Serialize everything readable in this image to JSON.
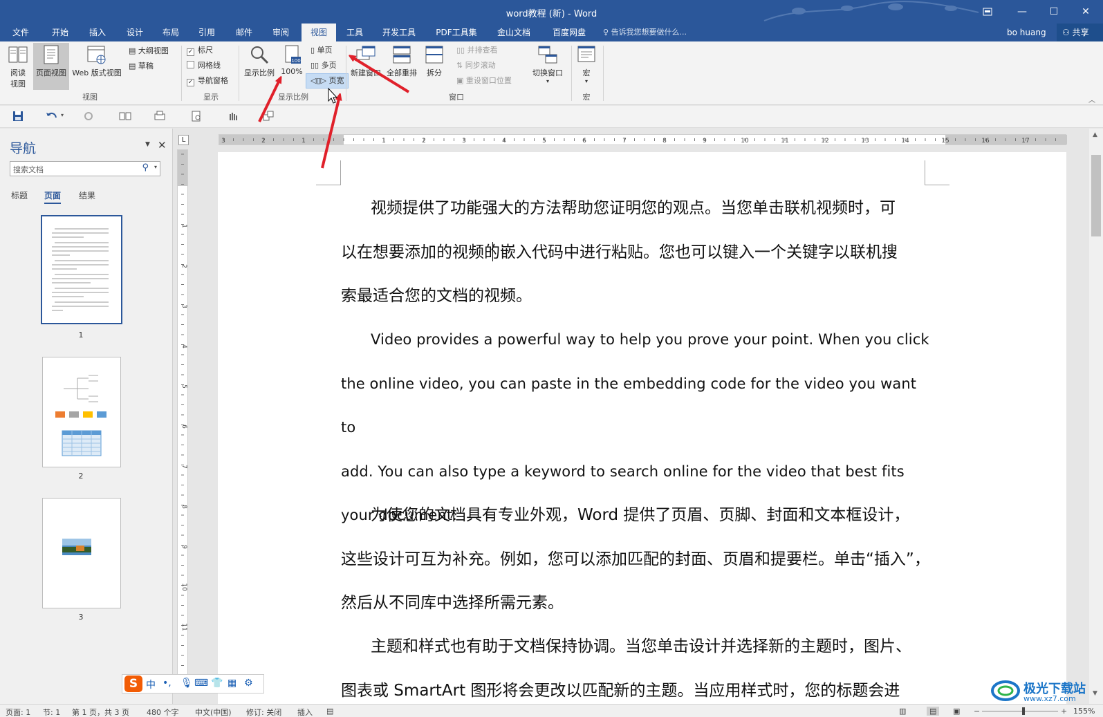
{
  "window": {
    "title": "word教程 (新) - Word",
    "restore_icon": "ribbon-display-icon",
    "minimize": "—",
    "maximize": "☐",
    "close": "✕"
  },
  "tabs": [
    "文件",
    "开始",
    "插入",
    "设计",
    "布局",
    "引用",
    "邮件",
    "审阅",
    "视图",
    "工具",
    "开发工具",
    "PDF工具集",
    "金山文档",
    "百度网盘"
  ],
  "active_tab": "视图",
  "tell_me": "告诉我您想要做什么...",
  "user": "bo huang",
  "share": "共享",
  "ribbon": {
    "views": {
      "read_mode": "阅读\n视图",
      "read_mode_l1": "阅读",
      "read_mode_l2": "视图",
      "print_layout": "页面视图",
      "web_layout": "Web 版式视图",
      "outline": "大纲视图",
      "draft": "草稿",
      "group": "视图"
    },
    "show": {
      "ruler": "标尺",
      "ruler_checked": true,
      "gridlines": "网格线",
      "gridlines_checked": false,
      "nav_pane": "导航窗格",
      "nav_pane_checked": true,
      "group": "显示"
    },
    "zoom": {
      "zoom": "显示比例",
      "hundred": "100%",
      "hundred_badge": "100",
      "one_page": "单页",
      "multi_page": "多页",
      "page_width": "页宽",
      "group": "显示比例"
    },
    "window": {
      "new_window": "新建窗口",
      "arrange_all": "全部重排",
      "split": "拆分",
      "side_by_side": "并排查看",
      "sync_scroll": "同步滚动",
      "reset_position": "重设窗口位置",
      "switch_windows": "切换窗口",
      "group": "窗口"
    },
    "macros": {
      "macros": "宏",
      "group": "宏"
    }
  },
  "nav": {
    "title": "导航",
    "search_placeholder": "搜索文档",
    "subtabs": [
      "标题",
      "页面",
      "结果"
    ],
    "active_subtab": "页面",
    "pages": [
      "1",
      "2",
      "3"
    ]
  },
  "ruler": {
    "tab_selector": "L",
    "h_labels": [
      "3",
      "2",
      "1",
      "1",
      "2",
      "3",
      "4",
      "5",
      "6",
      "7",
      "8",
      "9",
      "10",
      "11",
      "12",
      "13",
      "14",
      "15",
      "16",
      "17"
    ],
    "v_labels": [
      "1",
      "2",
      "3",
      "4",
      "5",
      "6",
      "7",
      "8",
      "9",
      "10",
      "11"
    ]
  },
  "document": {
    "p1_lines": [
      "视频提供了功能强大的方法帮助您证明您的观点。当您单击联机视频时，可",
      "以在想要添加的视频的嵌入代码中进行粘贴。您也可以键入一个关键字以联机搜",
      "索最适合您的文档的视频。"
    ],
    "p2_lines": [
      "Video provides a powerful way to help you prove your point. When you click",
      "the online video, you can paste in the embedding code for the video you want to",
      "add. You can also type a keyword to search online for the video that best fits",
      "your document."
    ],
    "p3_lines": [
      "为使您的文档具有专业外观，Word  提供了页眉、页脚、封面和文本框设计，",
      "这些设计可互为补充。例如，您可以添加匹配的封面、页眉和提要栏。单击“插入”，",
      "然后从不同库中选择所需元素。"
    ],
    "p4_lines": [
      "主题和样式也有助于文档保持协调。当您单击设计并选择新的主题时，图片、",
      "图表或  SmartArt  图形将会更改以匹配新的主题。当应用样式时，您的标题会进"
    ]
  },
  "ime": {
    "logo": "S",
    "mode": "中",
    "punct": "•,"
  },
  "status": {
    "page": "页面: 1",
    "section": "节: 1",
    "page_of": "第 1 页，共 3 页",
    "words": "480 个字",
    "language": "中文(中国)",
    "track": "修订: 关闭",
    "insert": "插入",
    "zoom": "155%"
  },
  "watermark": {
    "name": "极光下载站",
    "url": "www.xz7.com"
  },
  "colors": {
    "accent": "#2b579a",
    "arrow": "#e0202a"
  }
}
